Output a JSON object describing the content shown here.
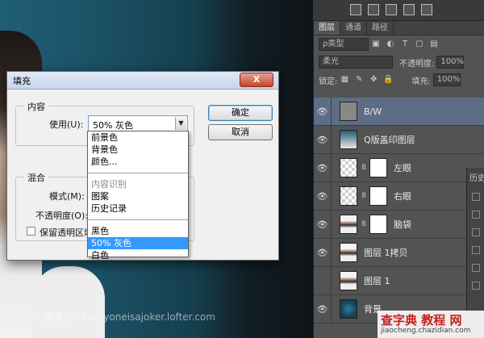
{
  "canvas": {
    "watermark": "© 冒滴汁 / everyoneisajoker.lofter.com"
  },
  "layers_panel": {
    "tabs": [
      "图层",
      "通道",
      "路径"
    ],
    "kind_filter": "ρ类型",
    "blend_mode": "柔光",
    "opacity_label": "不透明度:",
    "opacity_value": "100%",
    "lock_label": "锁定:",
    "fill_label": "填充:",
    "fill_value": "100%",
    "layers": [
      {
        "name": "B/W",
        "visible": true,
        "selected": true,
        "thumb": "gray",
        "mask": false
      },
      {
        "name": "Q版盖印图层",
        "visible": true,
        "selected": false,
        "thumb": "photo",
        "mask": false
      },
      {
        "name": "左眼",
        "visible": true,
        "selected": false,
        "thumb": "check",
        "mask": true
      },
      {
        "name": "右眼",
        "visible": true,
        "selected": false,
        "thumb": "check",
        "mask": true
      },
      {
        "name": "脑袋",
        "visible": true,
        "selected": false,
        "thumb": "person",
        "mask": true
      },
      {
        "name": "图层 1拷贝",
        "visible": true,
        "selected": false,
        "thumb": "person",
        "mask": false
      },
      {
        "name": "图层 1",
        "visible": false,
        "selected": false,
        "thumb": "person",
        "mask": false
      },
      {
        "name": "背景",
        "visible": true,
        "selected": false,
        "thumb": "blue",
        "mask": false
      }
    ]
  },
  "history_panel": {
    "tab": "历史"
  },
  "site_watermark": {
    "title": "查字典 教程 网",
    "url": "jiaocheng.chazidian.com"
  },
  "fill_dialog": {
    "title": "填充",
    "close_label": "X",
    "contents_group": "内容",
    "use_label": "使用(U):",
    "use_value": "50% 灰色",
    "blending_group": "混合",
    "mode_label": "模式(M):",
    "opacity_label": "不透明度(O):",
    "preserve_label": "保留透明区域",
    "ok_button": "确定",
    "cancel_button": "取消",
    "dropdown_groups": [
      [
        "前景色",
        "背景色",
        "颜色..."
      ],
      [
        "内容识别",
        "图案",
        "历史记录"
      ],
      [
        "黑色",
        "50% 灰色",
        "白色"
      ]
    ],
    "dropdown_disabled": "内容识别",
    "dropdown_selected": "50% 灰色"
  }
}
